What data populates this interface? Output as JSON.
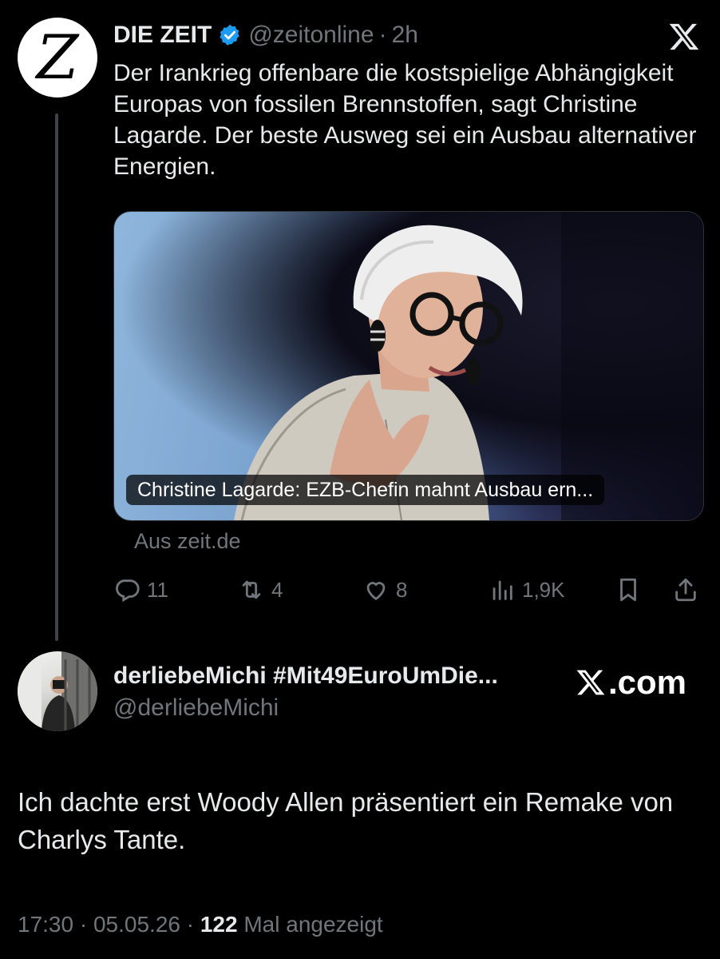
{
  "quoted_tweet": {
    "avatar_letter": "Z",
    "author_name": "DIE ZEIT",
    "handle": "@zeitonline",
    "separator": "·",
    "time": "2h",
    "text": "Der Irankrieg offenbare die kostspielige Abhängigkeit Europas von fossilen Brennstoffen, sagt Christine Lagarde. Der beste Ausweg sei ein Ausbau alternativer Energien.",
    "card": {
      "caption": "Christine Lagarde: EZB-Chefin mahnt Ausbau ern...",
      "source": "Aus zeit.de"
    },
    "actions": {
      "replies": "11",
      "reposts": "4",
      "likes": "8",
      "views": "1,9K"
    }
  },
  "reply_tweet": {
    "author_name": "derliebeMichi #Mit49EuroUmDie...",
    "handle": "@derliebeMichi",
    "watermark": ".com",
    "text": "Ich dachte erst Woody Allen präsentiert ein Remake von Charlys Tante.",
    "footer": {
      "time": "17:30",
      "sep1": " · ",
      "date": "05.05.26",
      "sep2": " · ",
      "views_count": "122",
      "views_label": " Mal angezeigt"
    }
  },
  "colors": {
    "background": "#000000",
    "text": "#e7e9ea",
    "muted": "#71767b",
    "verified": "#1d9bf0"
  }
}
